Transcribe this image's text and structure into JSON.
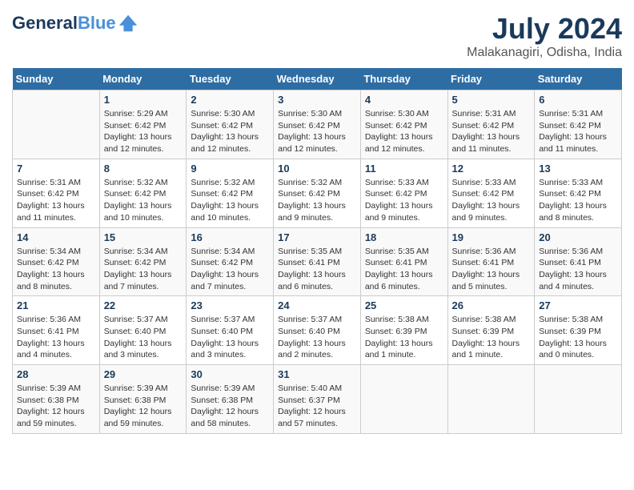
{
  "header": {
    "logo_line1": "General",
    "logo_line2": "Blue",
    "month_year": "July 2024",
    "location": "Malakanagiri, Odisha, India"
  },
  "weekdays": [
    "Sunday",
    "Monday",
    "Tuesday",
    "Wednesday",
    "Thursday",
    "Friday",
    "Saturday"
  ],
  "weeks": [
    [
      {
        "day": "",
        "sunrise": "",
        "sunset": "",
        "daylight": ""
      },
      {
        "day": "1",
        "sunrise": "Sunrise: 5:29 AM",
        "sunset": "Sunset: 6:42 PM",
        "daylight": "Daylight: 13 hours and 12 minutes."
      },
      {
        "day": "2",
        "sunrise": "Sunrise: 5:30 AM",
        "sunset": "Sunset: 6:42 PM",
        "daylight": "Daylight: 13 hours and 12 minutes."
      },
      {
        "day": "3",
        "sunrise": "Sunrise: 5:30 AM",
        "sunset": "Sunset: 6:42 PM",
        "daylight": "Daylight: 13 hours and 12 minutes."
      },
      {
        "day": "4",
        "sunrise": "Sunrise: 5:30 AM",
        "sunset": "Sunset: 6:42 PM",
        "daylight": "Daylight: 13 hours and 12 minutes."
      },
      {
        "day": "5",
        "sunrise": "Sunrise: 5:31 AM",
        "sunset": "Sunset: 6:42 PM",
        "daylight": "Daylight: 13 hours and 11 minutes."
      },
      {
        "day": "6",
        "sunrise": "Sunrise: 5:31 AM",
        "sunset": "Sunset: 6:42 PM",
        "daylight": "Daylight: 13 hours and 11 minutes."
      }
    ],
    [
      {
        "day": "7",
        "sunrise": "Sunrise: 5:31 AM",
        "sunset": "Sunset: 6:42 PM",
        "daylight": "Daylight: 13 hours and 11 minutes."
      },
      {
        "day": "8",
        "sunrise": "Sunrise: 5:32 AM",
        "sunset": "Sunset: 6:42 PM",
        "daylight": "Daylight: 13 hours and 10 minutes."
      },
      {
        "day": "9",
        "sunrise": "Sunrise: 5:32 AM",
        "sunset": "Sunset: 6:42 PM",
        "daylight": "Daylight: 13 hours and 10 minutes."
      },
      {
        "day": "10",
        "sunrise": "Sunrise: 5:32 AM",
        "sunset": "Sunset: 6:42 PM",
        "daylight": "Daylight: 13 hours and 9 minutes."
      },
      {
        "day": "11",
        "sunrise": "Sunrise: 5:33 AM",
        "sunset": "Sunset: 6:42 PM",
        "daylight": "Daylight: 13 hours and 9 minutes."
      },
      {
        "day": "12",
        "sunrise": "Sunrise: 5:33 AM",
        "sunset": "Sunset: 6:42 PM",
        "daylight": "Daylight: 13 hours and 9 minutes."
      },
      {
        "day": "13",
        "sunrise": "Sunrise: 5:33 AM",
        "sunset": "Sunset: 6:42 PM",
        "daylight": "Daylight: 13 hours and 8 minutes."
      }
    ],
    [
      {
        "day": "14",
        "sunrise": "Sunrise: 5:34 AM",
        "sunset": "Sunset: 6:42 PM",
        "daylight": "Daylight: 13 hours and 8 minutes."
      },
      {
        "day": "15",
        "sunrise": "Sunrise: 5:34 AM",
        "sunset": "Sunset: 6:42 PM",
        "daylight": "Daylight: 13 hours and 7 minutes."
      },
      {
        "day": "16",
        "sunrise": "Sunrise: 5:34 AM",
        "sunset": "Sunset: 6:42 PM",
        "daylight": "Daylight: 13 hours and 7 minutes."
      },
      {
        "day": "17",
        "sunrise": "Sunrise: 5:35 AM",
        "sunset": "Sunset: 6:41 PM",
        "daylight": "Daylight: 13 hours and 6 minutes."
      },
      {
        "day": "18",
        "sunrise": "Sunrise: 5:35 AM",
        "sunset": "Sunset: 6:41 PM",
        "daylight": "Daylight: 13 hours and 6 minutes."
      },
      {
        "day": "19",
        "sunrise": "Sunrise: 5:36 AM",
        "sunset": "Sunset: 6:41 PM",
        "daylight": "Daylight: 13 hours and 5 minutes."
      },
      {
        "day": "20",
        "sunrise": "Sunrise: 5:36 AM",
        "sunset": "Sunset: 6:41 PM",
        "daylight": "Daylight: 13 hours and 4 minutes."
      }
    ],
    [
      {
        "day": "21",
        "sunrise": "Sunrise: 5:36 AM",
        "sunset": "Sunset: 6:41 PM",
        "daylight": "Daylight: 13 hours and 4 minutes."
      },
      {
        "day": "22",
        "sunrise": "Sunrise: 5:37 AM",
        "sunset": "Sunset: 6:40 PM",
        "daylight": "Daylight: 13 hours and 3 minutes."
      },
      {
        "day": "23",
        "sunrise": "Sunrise: 5:37 AM",
        "sunset": "Sunset: 6:40 PM",
        "daylight": "Daylight: 13 hours and 3 minutes."
      },
      {
        "day": "24",
        "sunrise": "Sunrise: 5:37 AM",
        "sunset": "Sunset: 6:40 PM",
        "daylight": "Daylight: 13 hours and 2 minutes."
      },
      {
        "day": "25",
        "sunrise": "Sunrise: 5:38 AM",
        "sunset": "Sunset: 6:39 PM",
        "daylight": "Daylight: 13 hours and 1 minute."
      },
      {
        "day": "26",
        "sunrise": "Sunrise: 5:38 AM",
        "sunset": "Sunset: 6:39 PM",
        "daylight": "Daylight: 13 hours and 1 minute."
      },
      {
        "day": "27",
        "sunrise": "Sunrise: 5:38 AM",
        "sunset": "Sunset: 6:39 PM",
        "daylight": "Daylight: 13 hours and 0 minutes."
      }
    ],
    [
      {
        "day": "28",
        "sunrise": "Sunrise: 5:39 AM",
        "sunset": "Sunset: 6:38 PM",
        "daylight": "Daylight: 12 hours and 59 minutes."
      },
      {
        "day": "29",
        "sunrise": "Sunrise: 5:39 AM",
        "sunset": "Sunset: 6:38 PM",
        "daylight": "Daylight: 12 hours and 59 minutes."
      },
      {
        "day": "30",
        "sunrise": "Sunrise: 5:39 AM",
        "sunset": "Sunset: 6:38 PM",
        "daylight": "Daylight: 12 hours and 58 minutes."
      },
      {
        "day": "31",
        "sunrise": "Sunrise: 5:40 AM",
        "sunset": "Sunset: 6:37 PM",
        "daylight": "Daylight: 12 hours and 57 minutes."
      },
      {
        "day": "",
        "sunrise": "",
        "sunset": "",
        "daylight": ""
      },
      {
        "day": "",
        "sunrise": "",
        "sunset": "",
        "daylight": ""
      },
      {
        "day": "",
        "sunrise": "",
        "sunset": "",
        "daylight": ""
      }
    ]
  ]
}
